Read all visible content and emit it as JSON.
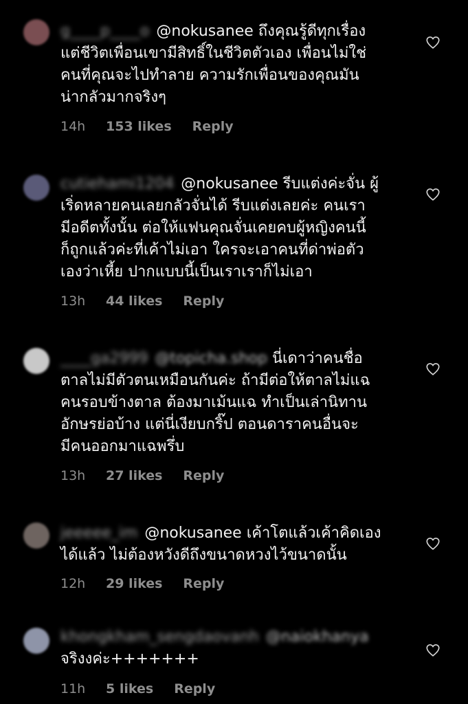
{
  "comments": [
    {
      "username": "g____p____o",
      "mention": "@nokusanee",
      "mention_blurred": false,
      "text": "ถึงคุณรู้ดีทุกเรื่อง\nแต่ชีวิตเพื่อนเขามีสิทธิ์ในชีวิตตัวเอง เพื่อนไม่ใช่\nคนที่คุณจะไปทำลาย ความรักเพื่อนของคุณมัน\nน่ากลัวมากจริงๆ",
      "time": "14h",
      "likes": "153 likes",
      "reply": "Reply",
      "avatar_color": "#7a4e52"
    },
    {
      "username": "cutiehami1204",
      "mention": "@nokusanee",
      "mention_blurred": false,
      "text": "รีบแต่งค่ะจั่น ผู้\nเริ่ดหลายคนเลยกลัวจั่นได้ รีบแต่งเลยค่ะ คนเรา\nมีอดีตทั้งนั้น ต่อให้แฟนคุณจั่นเคยคบผู้หญิงคนนี้\nก็ถูกแล้วค่ะที่เค้าไม่เอา ใครจะเอาคนที่ด่าพ่อตัว\nเองว่าเหี้ย ปากแบบนี้เป็นเราเราก็ไม่เอา",
      "time": "13h",
      "likes": "44 likes",
      "reply": "Reply",
      "avatar_color": "#5a5a78"
    },
    {
      "username": "____ga2999",
      "mention": "@topicha.shop",
      "mention_blurred": true,
      "text": "นี่เดาว่าคนชื่อ\nตาลไม่มีตัวตนเหมือนกันค่ะ ถ้ามีต่อให้ตาลไม่แฉ\nคนรอบข้างตาล ต้องมาเม้นแฉ ทำเป็นเล่านิทาน\nอักษรย่อบ้าง แต่นี่เงียบกริ๊ป  ตอนดาราคนอื่นจะ\nมีคนออกมาแฉพรึ่บ",
      "time": "13h",
      "likes": "27 likes",
      "reply": "Reply",
      "avatar_color": "#c8c8c8"
    },
    {
      "username": "jeeeee_im",
      "mention": "@nokusanee",
      "mention_blurred": false,
      "text": "เค้าโตแล้วเค้าคิดเอง\nได้แล้ว ไม่ต้องหวังดีถึงขนาดหวงไว้ขนาดนั้น",
      "time": "12h",
      "likes": "29 likes",
      "reply": "Reply",
      "avatar_color": "#6e6460"
    },
    {
      "username": "khongkham_sengdaovanh",
      "mention": "@naiokhanya",
      "mention_blurred": true,
      "text": "\nจริงงค่ะ+++++++",
      "time": "11h",
      "likes": "5 likes",
      "reply": "Reply",
      "avatar_color": "#8e94a8"
    }
  ],
  "icons": {
    "like": "heart-outline-icon"
  },
  "colors": {
    "background": "#000000",
    "text": "#f2f2f2",
    "meta": "#8e8e8e"
  }
}
